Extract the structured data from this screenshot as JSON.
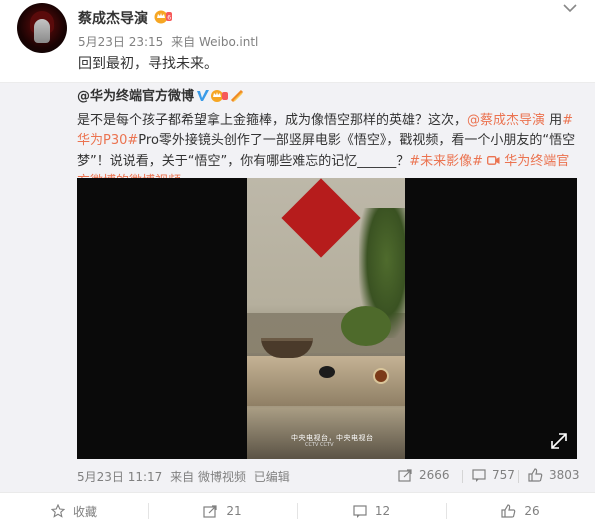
{
  "post": {
    "author": "蔡成杰导演",
    "date": "5月23日 23:15",
    "source": "来自 Weibo.intl",
    "text": "回到最初，寻找未来。"
  },
  "repost": {
    "author": "@华为终端官方微博",
    "text_1": "是不是每个孩子都希望拿上金箍棒，成为像悟空那样的英雄？这次，",
    "mention": "@蔡成杰导演",
    "text_2": " 用",
    "hashtag_p30": "#华为P30#",
    "text_3": "Pro零外接镜头创作了一部竖屏电影《悟空》，戳视频，看一个小朋友的“悟空梦”！说说看，关于“悟空”，你有哪些难忘的记忆______？",
    "hashtag_future": "#未来影像#",
    "video_link": "华为终端官方微博的微博视频",
    "video": {
      "subtitle": "中央电视台，中央电视台",
      "subtitle_small": "CCTV CCTV"
    },
    "date": "5月23日 11:17",
    "source": "来自 微博视频",
    "edited": "已编辑",
    "reposts": "2666",
    "comments": "757",
    "likes": "3803"
  },
  "actions": {
    "favorite": "收藏",
    "repost_count": "21",
    "comment_count": "12",
    "like_count": "26"
  },
  "colors": {
    "link_orange": "#eb7350",
    "verified_blue": "#3a9be8",
    "red_banner": "#b61c1c"
  }
}
